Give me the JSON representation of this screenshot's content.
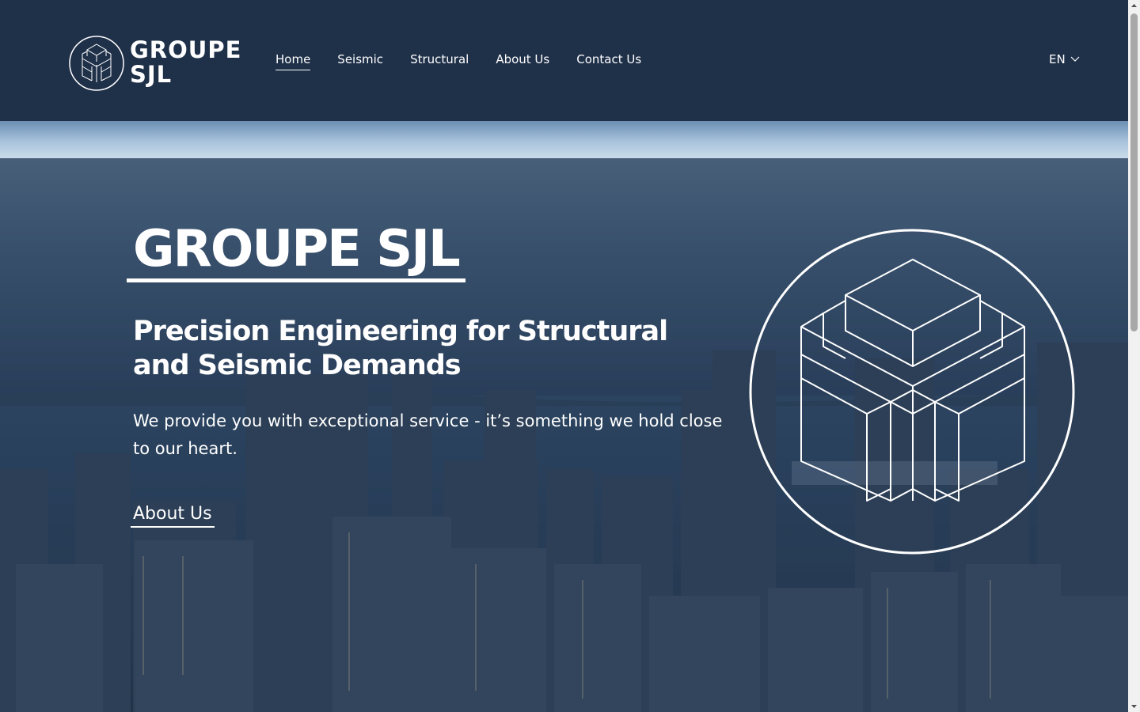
{
  "header": {
    "logo_text_line1": "GROUPE",
    "logo_text_line2": "SJL",
    "nav": [
      {
        "label": "Home",
        "active": true
      },
      {
        "label": "Seismic",
        "active": false
      },
      {
        "label": "Structural",
        "active": false
      },
      {
        "label": "About Us",
        "active": false
      },
      {
        "label": "Contact Us",
        "active": false
      }
    ],
    "language": "EN",
    "language_icon": "chevron-down-icon"
  },
  "hero": {
    "title": "GROUPE SJL",
    "subtitle": "Precision Engineering for Structural and Seismic Demands",
    "text": "We provide you with exceptional service - it’s something we hold close to our heart.",
    "link_label": "About Us",
    "emblem_icon": "building-cube-logo-icon"
  },
  "colors": {
    "header_bg": "#1f3049",
    "text": "#ffffff"
  }
}
